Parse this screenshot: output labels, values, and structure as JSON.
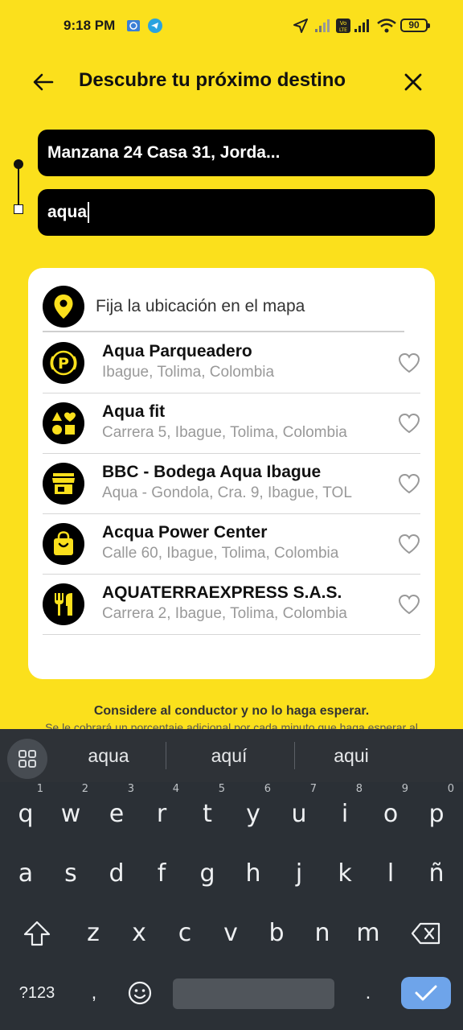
{
  "status_bar": {
    "time": "9:18 PM",
    "battery": "90",
    "icons": [
      "alarm-icon",
      "telegram-icon",
      "location-arrow-icon",
      "signal-icon",
      "volte-icon",
      "wifi-icon",
      "battery-icon"
    ]
  },
  "header": {
    "title": "Descubre tu próximo destino",
    "back_icon": "arrow-left-icon",
    "close_icon": "close-icon"
  },
  "route": {
    "origin_value": "Manzana 24 Casa 31, Jorda...",
    "destination_value": "aqua"
  },
  "results": {
    "map_option_label": "Fija la ubicación en el mapa",
    "items": [
      {
        "name": "Aqua Parqueadero",
        "address": "Ibague, Tolima, Colombia",
        "icon": "parking-icon"
      },
      {
        "name": "Aqua fit",
        "address": "Carrera 5, Ibague, Tolima, Colombia",
        "icon": "shapes-icon"
      },
      {
        "name": "BBC - Bodega Aqua Ibague",
        "address": "Aqua - Gondola, Cra. 9, Ibague, TOL",
        "icon": "store-icon"
      },
      {
        "name": "Acqua Power Center",
        "address": "Calle 60, Ibague, Tolima, Colombia",
        "icon": "shopping-bag-icon"
      },
      {
        "name": "AQUATERRAEXPRESS S.A.S.",
        "address": "Carrera 2, Ibague, Tolima, Colombia",
        "icon": "restaurant-icon"
      }
    ]
  },
  "notice": {
    "title": "Considere al conductor y no lo haga esperar.",
    "subtitle": "Se le cobrará un porcentaje adicional por cada minuto que haga esperar al"
  },
  "keyboard": {
    "suggestions": [
      "aqua",
      "aquí",
      "aqui"
    ],
    "row1": [
      "q",
      "w",
      "e",
      "r",
      "t",
      "y",
      "u",
      "i",
      "o",
      "p"
    ],
    "row1_numbers": [
      "1",
      "2",
      "3",
      "4",
      "5",
      "6",
      "7",
      "8",
      "9",
      "0"
    ],
    "row2": [
      "a",
      "s",
      "d",
      "f",
      "g",
      "h",
      "j",
      "k",
      "l",
      "ñ"
    ],
    "row3": [
      "z",
      "x",
      "c",
      "v",
      "b",
      "n",
      "m"
    ],
    "symbols_label": "?123",
    "comma": ",",
    "period": "."
  },
  "colors": {
    "brand_yellow": "#FBE01C",
    "keyboard_bg": "#2b3036",
    "enter_blue": "#6ea4ea"
  }
}
